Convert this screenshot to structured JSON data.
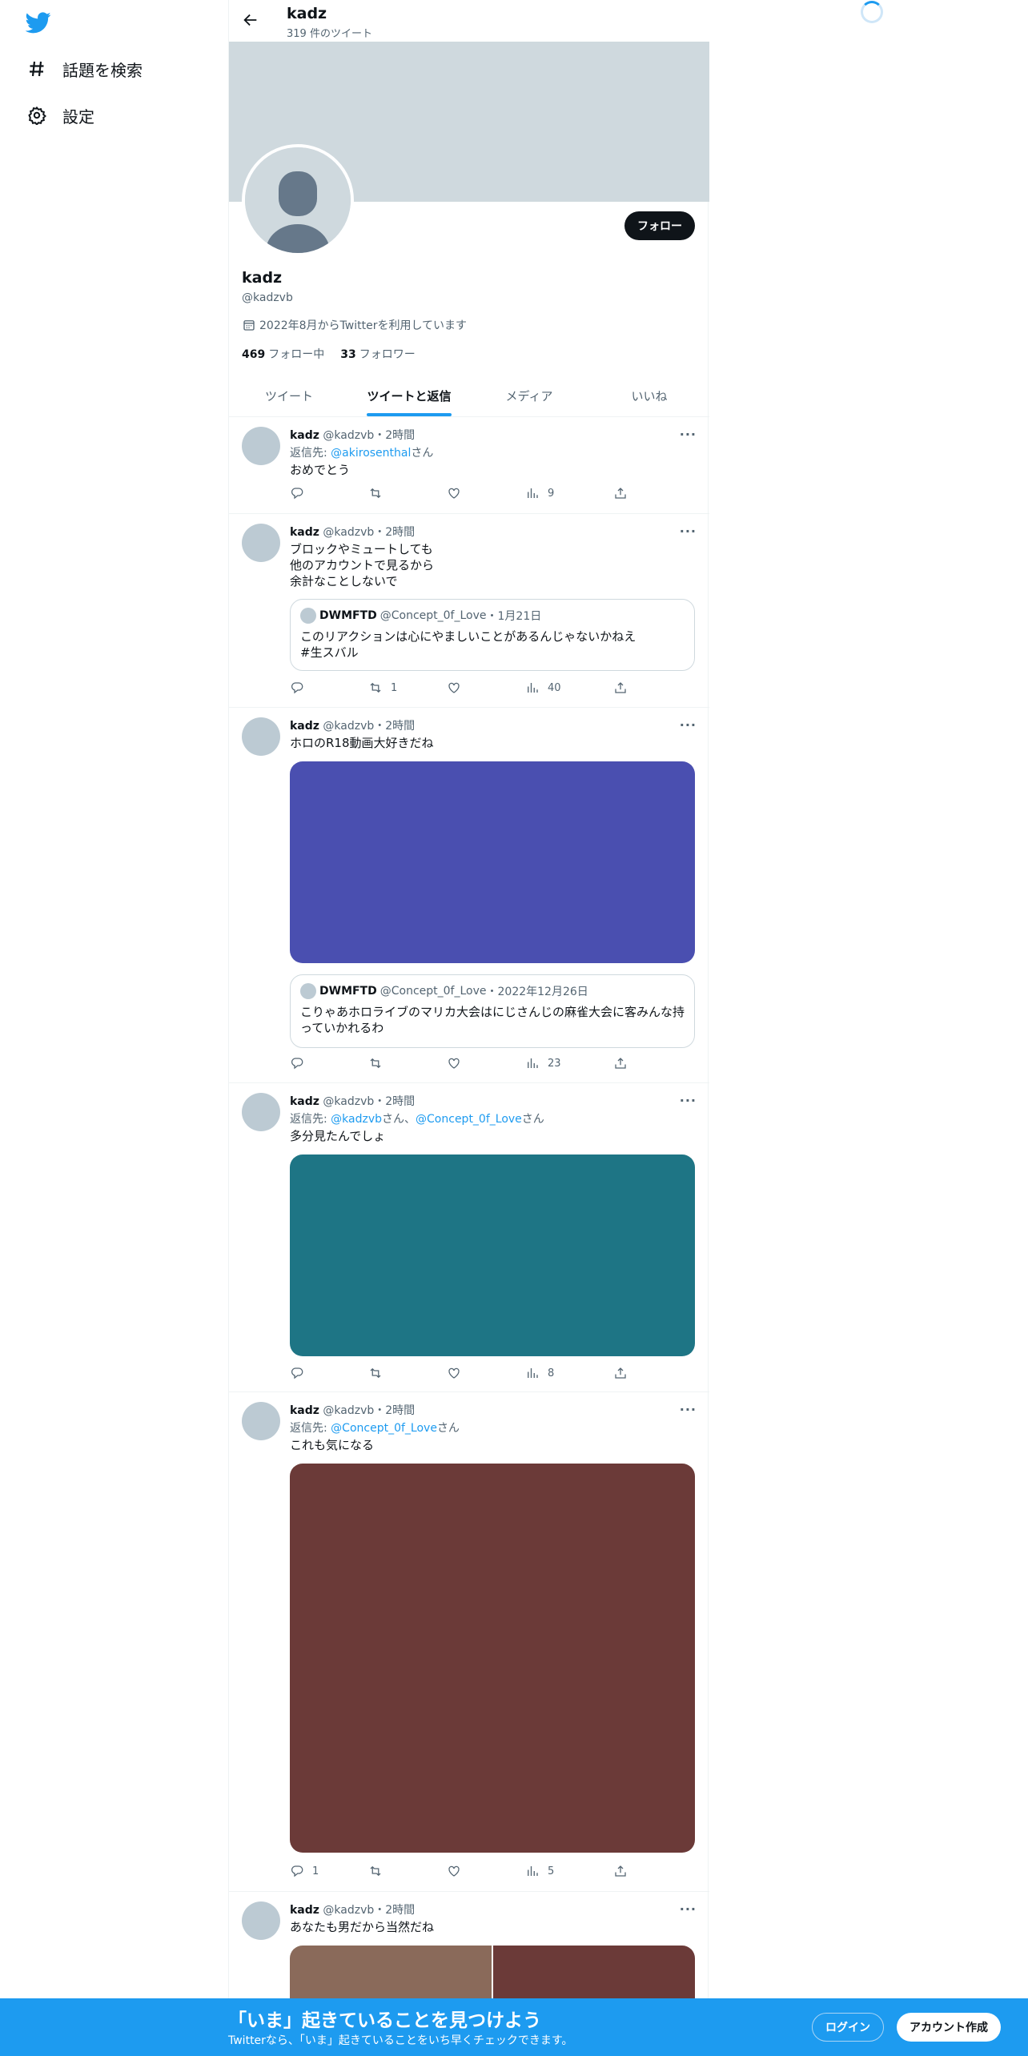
{
  "colors": {
    "accent": "#1d9bf0",
    "banner": "#cfd9de"
  },
  "nav": {
    "logo_icon": "twitter-bird-icon",
    "items": [
      {
        "icon": "hashtag-icon",
        "label": "話題を検索"
      },
      {
        "icon": "gear-icon",
        "label": "設定"
      }
    ]
  },
  "header": {
    "name": "kadz",
    "tweet_count": "319 件のツイート"
  },
  "profile": {
    "follow_label": "フォロー",
    "name": "kadz",
    "handle": "@kadzvb",
    "joined": "2022年8月からTwitterを利用しています",
    "following_count": "469",
    "following_label": "フォロー中",
    "followers_count": "33",
    "followers_label": "フォロワー"
  },
  "tabs": [
    {
      "label": "ツイート",
      "active": false
    },
    {
      "label": "ツイートと返信",
      "active": true
    },
    {
      "label": "メディア",
      "active": false
    },
    {
      "label": "いいね",
      "active": false
    }
  ],
  "tweets": [
    {
      "name": "kadz",
      "handle": "@kadzvb",
      "time": "・2時間",
      "reply_prefix": "返信先: ",
      "reply_to": "@akirosenthal",
      "reply_suffix": "さん",
      "text": "おめでとう",
      "reply_count": "",
      "retweet_count": "",
      "like_count": "",
      "view_count": "9"
    },
    {
      "name": "kadz",
      "handle": "@kadzvb",
      "time": "・2時間",
      "text": "ブロックやミュートしても\n他のアカウントで見るから\n余計なことしないで",
      "quote": {
        "name": "DWMFTD",
        "handle": "@Concept_0f_Love",
        "time": "・1月21日",
        "text": "このリアクションは心にやましいことがあるんじゃないかねえ\n #生スバル"
      },
      "reply_count": "",
      "retweet_count": "1",
      "like_count": "",
      "view_count": "40"
    },
    {
      "name": "kadz",
      "handle": "@kadzvb",
      "time": "・2時間",
      "text": "ホロのR18動画大好きだね",
      "media_color": "#4a4fb0",
      "quote": {
        "name": "DWMFTD",
        "handle": "@Concept_0f_Love",
        "time": "・2022年12月26日",
        "text": "こりゃあホロライブのマリカ大会はにじさんじの麻雀大会に客みんな持っていかれるわ"
      },
      "reply_count": "",
      "retweet_count": "",
      "like_count": "",
      "view_count": "23"
    },
    {
      "name": "kadz",
      "handle": "@kadzvb",
      "time": "・2時間",
      "reply_prefix": "返信先: ",
      "reply_to": "@kadzvb",
      "reply_mid": "さん、",
      "reply_to2": "@Concept_0f_Love",
      "reply_suffix": "さん",
      "text": "多分見たんでしょ",
      "media_color": "#1e7585",
      "reply_count": "",
      "retweet_count": "",
      "like_count": "",
      "view_count": "8"
    },
    {
      "name": "kadz",
      "handle": "@kadzvb",
      "time": "・2時間",
      "reply_prefix": "返信先: ",
      "reply_to": "@Concept_0f_Love",
      "reply_suffix": "さん",
      "text": "これも気になる",
      "media_color": "#6b3a38",
      "reply_count": "1",
      "retweet_count": "",
      "like_count": "",
      "view_count": "5"
    },
    {
      "name": "kadz",
      "handle": "@kadzvb",
      "time": "・2時間",
      "text": "あなたも男だから当然だね",
      "media_colors": [
        "#8a6a5a",
        "#6b3a38"
      ]
    }
  ],
  "bottom_bar": {
    "title": "「いま」起きていることを見つけよう",
    "subtitle": "Twitterなら、「いま」起きていることをいち早くチェックできます。",
    "login_label": "ログイン",
    "signup_label": "アカウント作成"
  }
}
